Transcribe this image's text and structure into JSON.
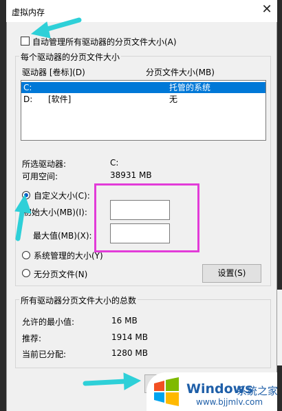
{
  "dialog": {
    "title": "虚拟内存",
    "close_glyph": "✕"
  },
  "auto_manage": {
    "label": "自动管理所有驱动器的分页文件大小(A)",
    "checked": false
  },
  "per_drive_group": {
    "label": "每个驱动器的分页文件大小",
    "columns": {
      "drive": "驱动器 [卷标](D)",
      "size": "分页文件大小(MB)"
    },
    "rows": [
      {
        "drive": "C:",
        "label": "",
        "size": "托管的系统",
        "selected": true
      },
      {
        "drive": "D:",
        "label": "[软件]",
        "size": "无",
        "selected": false
      }
    ],
    "selected_drive_label": "所选驱动器:",
    "selected_drive_value": "C:",
    "free_space_label": "可用空间:",
    "free_space_value": "38931 MB",
    "custom_size_label": "自定义大小(C):",
    "initial_size_label": "初始大小(MB)(I):",
    "initial_size_value": "",
    "max_size_label": "最大值(MB)(X):",
    "max_size_value": "",
    "system_managed_label": "系统管理的大小(Y)",
    "no_paging_label": "无分页文件(N)",
    "set_button": "设置(S)"
  },
  "totals_group": {
    "label": "所有驱动器分页文件大小的总数",
    "min_label": "允许的最小值:",
    "min_value": "16 MB",
    "recommended_label": "推荐:",
    "recommended_value": "1914 MB",
    "current_label": "当前已分配:",
    "current_value": "1280 MB"
  },
  "watermark": {
    "brand": "Windows",
    "cn": "系统之家",
    "url": "www.bjjmlv.com"
  },
  "colors": {
    "selection": "#0078d7",
    "highlight_box": "#e23bd8",
    "arrow": "#2ed0d8"
  }
}
